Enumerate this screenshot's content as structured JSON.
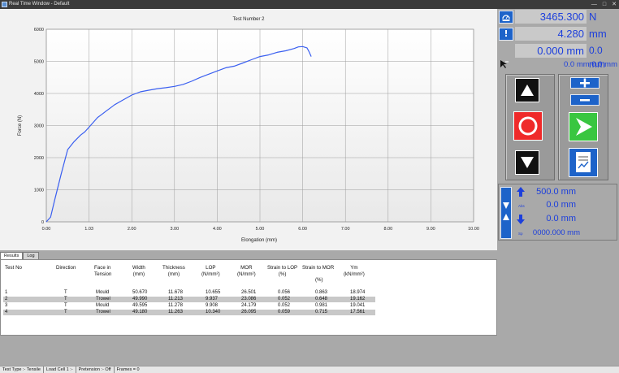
{
  "window": {
    "title": "Real Time Window - Default",
    "controls": [
      "—",
      "□",
      "✕"
    ]
  },
  "chart_data": {
    "type": "line",
    "title": "Test Number 2",
    "xlabel": "Elongation (mm)",
    "ylabel": "Force (N)",
    "xlim": [
      0,
      10
    ],
    "ylim": [
      0,
      6000
    ],
    "xticks": [
      "0.00",
      "1.03",
      "2.00",
      "3.00",
      "4.00",
      "5.00",
      "6.00",
      "7.00",
      "8.00",
      "9.00",
      "10.00"
    ],
    "yticks": [
      "0",
      "1000",
      "2000",
      "3000",
      "4000",
      "5000",
      "6000"
    ],
    "grid": true,
    "color": "#3a5ff0",
    "series": [
      {
        "x": [
          0,
          0.1,
          0.2,
          0.35,
          0.5,
          0.65,
          0.8,
          0.9,
          1.0,
          1.1,
          1.2,
          1.3,
          1.4,
          1.5,
          1.6,
          1.8,
          2.0,
          2.2,
          2.4,
          2.6,
          2.8,
          3.0,
          3.2,
          3.4,
          3.6,
          3.8,
          4.0,
          4.2,
          4.4,
          4.6,
          4.8,
          5.0,
          5.2,
          5.4,
          5.6,
          5.8,
          5.9,
          6.0,
          6.1,
          6.15,
          6.2
        ],
        "y": [
          0,
          150,
          700,
          1500,
          2250,
          2500,
          2700,
          2800,
          2950,
          3100,
          3250,
          3350,
          3450,
          3550,
          3650,
          3800,
          3950,
          4050,
          4100,
          4150,
          4180,
          4220,
          4280,
          4380,
          4500,
          4600,
          4700,
          4800,
          4850,
          4950,
          5050,
          5150,
          5200,
          5280,
          5330,
          5400,
          5450,
          5460,
          5420,
          5300,
          5150
        ]
      }
    ]
  },
  "tabs": [
    {
      "label": "Results"
    },
    {
      "label": "Log"
    }
  ],
  "results": {
    "headers": [
      {
        "l1": "Test No",
        "l2": ""
      },
      {
        "l1": "Direction",
        "l2": ""
      },
      {
        "l1": "Face in",
        "l2": "Tension"
      },
      {
        "l1": "Width",
        "l2": "(mm)"
      },
      {
        "l1": "Thickness",
        "l2": "(mm)"
      },
      {
        "l1": "LOP",
        "l2": "(N/mm²)"
      },
      {
        "l1": "MOR",
        "l2": "(N/mm²)"
      },
      {
        "l1": "Strain to LOP",
        "l2": "(%)"
      },
      {
        "l1": "Strain to MOR",
        "l2": ""
      },
      {
        "l1": "Ym",
        "l2": "(kN/mm²)"
      }
    ],
    "strain_mor_unit": "(%)",
    "rows": [
      [
        "1",
        "T",
        "Mould",
        "50.670",
        "11.678",
        "10.655",
        "26.501",
        "0.056",
        "0.863",
        "18.974"
      ],
      [
        "2",
        "T",
        "Trowel",
        "49.990",
        "11.213",
        "9.937",
        "23.086",
        "0.052",
        "0.648",
        "19.162"
      ],
      [
        "3",
        "T",
        "Mould",
        "49.595",
        "11.278",
        "9.908",
        "24.179",
        "0.052",
        "0.981",
        "19.041"
      ],
      [
        "4",
        "T",
        "Trowel",
        "49.180",
        "11.263",
        "10.340",
        "26.095",
        "0.059",
        "0.715",
        "17.561"
      ]
    ]
  },
  "status": {
    "test_type": "Test Type :- Tensile",
    "load_cell": "Load Cell 1 :-",
    "pretension": "Pretension :- Off",
    "frames": "Frames = 0"
  },
  "readouts": {
    "force_value": "3465.300",
    "force_unit": "N",
    "ext_value": "4.280",
    "ext_unit": "mm",
    "box3_value": "0.000 mm",
    "box3_extra": "0.0 mm",
    "small_line": "0.0 mm 0.0 mm"
  },
  "position": {
    "target": "500.0 mm",
    "abs_label": "Abs",
    "abs_value": "0.0 mm",
    "rel_value": "0.0 mm",
    "sp_label": "Sp",
    "speed": "0000.000 mm"
  },
  "icons": {
    "force": "scale-icon",
    "extension": "alert-icon",
    "zero": "zero-cursor-icon",
    "up": "up-arrow-icon",
    "stop": "stop-icon",
    "down": "down-arrow-icon",
    "plus": "plus-icon",
    "minus": "minus-icon",
    "start": "play-icon",
    "report": "report-icon"
  }
}
